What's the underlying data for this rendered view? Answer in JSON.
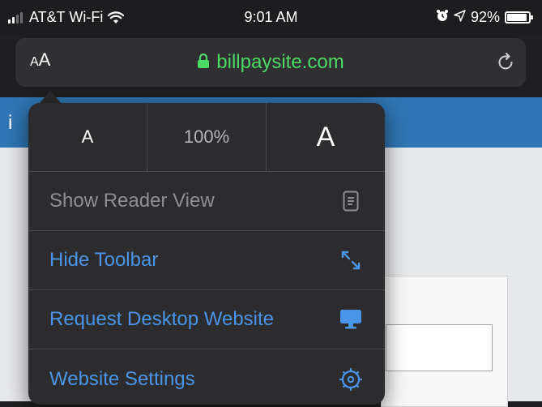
{
  "status_bar": {
    "carrier": "AT&T Wi-Fi",
    "time": "9:01 AM",
    "battery_percent": "92%",
    "battery_level": 0.92
  },
  "url_bar": {
    "aa_small": "A",
    "aa_large": "A",
    "domain": "billpaysite.com"
  },
  "page": {
    "banner_text": "i"
  },
  "popover": {
    "font_decrease": "A",
    "zoom_level": "100%",
    "font_increase": "A",
    "items": [
      {
        "label": "Show Reader View",
        "icon": "reader-icon",
        "enabled": false
      },
      {
        "label": "Hide Toolbar",
        "icon": "resize-arrows-icon",
        "enabled": true
      },
      {
        "label": "Request Desktop Website",
        "icon": "desktop-icon",
        "enabled": true
      },
      {
        "label": "Website Settings",
        "icon": "settings-gear-icon",
        "enabled": true
      }
    ]
  },
  "colors": {
    "accent_blue": "#4a95e8",
    "secure_green": "#4cd964",
    "banner_blue": "#2f76b4"
  }
}
